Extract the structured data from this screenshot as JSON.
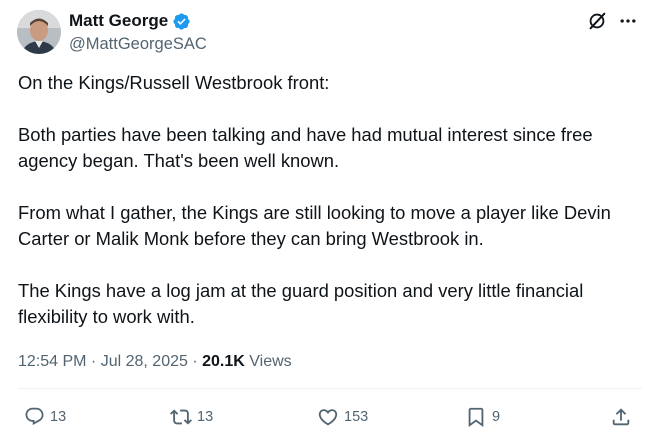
{
  "author": {
    "display_name": "Matt George",
    "handle": "@MattGeorgeSAC",
    "verified": true,
    "avatar_icon": "profile-photo"
  },
  "tweet": {
    "paragraphs": [
      "On the Kings/Russell Westbrook front:",
      "Both parties have been talking and have had mutual interest since free agency began. That's been well known.",
      "From what I gather, the Kings are still looking to move a player like Devin Carter or Malik Monk before they can bring Westbrook in.",
      "The Kings have a log jam at the guard position and very little financial flexibility to work with."
    ]
  },
  "meta": {
    "time": "12:54 PM",
    "separator": " · ",
    "date": "Jul 28, 2025",
    "views_count": "20.1K",
    "views_label": " Views"
  },
  "actions": {
    "replies": "13",
    "reposts": "13",
    "likes": "153",
    "bookmarks": "9"
  },
  "icons": {
    "grok": "grok-icon",
    "more": "more-icon",
    "reply": "reply-icon",
    "repost": "repost-icon",
    "like": "like-icon",
    "bookmark": "bookmark-icon",
    "share": "share-icon"
  },
  "colors": {
    "text": "#0f1419",
    "secondary": "#536471",
    "verified": "#1d9bf0",
    "divider": "#eff3f4"
  }
}
